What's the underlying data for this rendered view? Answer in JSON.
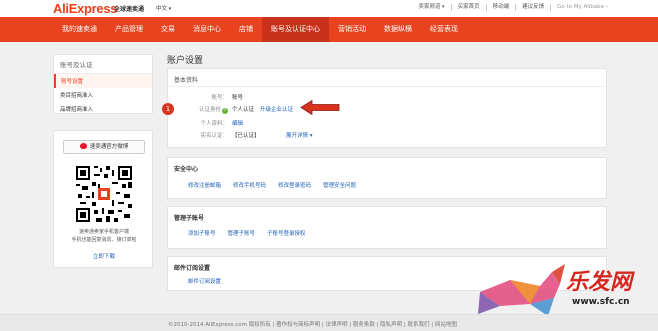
{
  "header": {
    "logo": "AliExpress",
    "logo_sub": "全球速卖通",
    "language": "中文",
    "links": [
      "卖家频道",
      "买家首页",
      "移动端",
      "建议反馈",
      "Go to My Alibaba"
    ]
  },
  "nav": {
    "items": [
      "我的速卖通",
      "产品管理",
      "交易",
      "消息中心",
      "店铺",
      "账号及认证中心",
      "营销活动",
      "数据纵横",
      "经营表现"
    ],
    "active_index": 5
  },
  "sidebar": {
    "title": "账号及认证",
    "items": [
      "账号设置",
      "类目招商准入",
      "品牌招商准入"
    ],
    "active_index": 0
  },
  "weibo": {
    "button_label": "速卖通官方微博",
    "qr_text_line1": "速卖通卖家手机客户端",
    "qr_text_line2": "手机也能回复消息、接订单啦",
    "download_label": "立即下载"
  },
  "main": {
    "page_title": "账户设置",
    "basic": {
      "title": "基本资料",
      "account_label": "账号：",
      "account_value": "账号",
      "auth_label": "认证身份",
      "auth_value": "个人认证",
      "auth_upgrade_link": "升级企业认证",
      "personal_label": "个人资料：",
      "personal_link": "编辑",
      "realname_label": "实名认证：",
      "realname_value": "【已认证】",
      "realname_link": "展开详情",
      "step_badge": "1"
    },
    "security": {
      "title": "安全中心",
      "links": [
        "修改注册邮箱",
        "修改手机号码",
        "修改登录密码",
        "管理安全问题"
      ]
    },
    "subaccount": {
      "title": "管理子账号",
      "links": [
        "添加子账号",
        "管理子账号",
        "子账号登录授权"
      ]
    },
    "mail": {
      "title": "邮件订阅设置",
      "links": [
        "邮件订阅设置"
      ]
    }
  },
  "footer": {
    "text": "©2010-2014 AliExpress.com 版权所有 | 著作权与商标声明 | 法律声明 | 服务条款 | 隐私声明 | 联系我们 | 网站地图"
  },
  "watermark": {
    "text": "乐发网",
    "url": "www.sfc.cn"
  },
  "colors": {
    "brand": "#e8421e",
    "link": "#1e5fb8",
    "badge": "#d9331f"
  }
}
